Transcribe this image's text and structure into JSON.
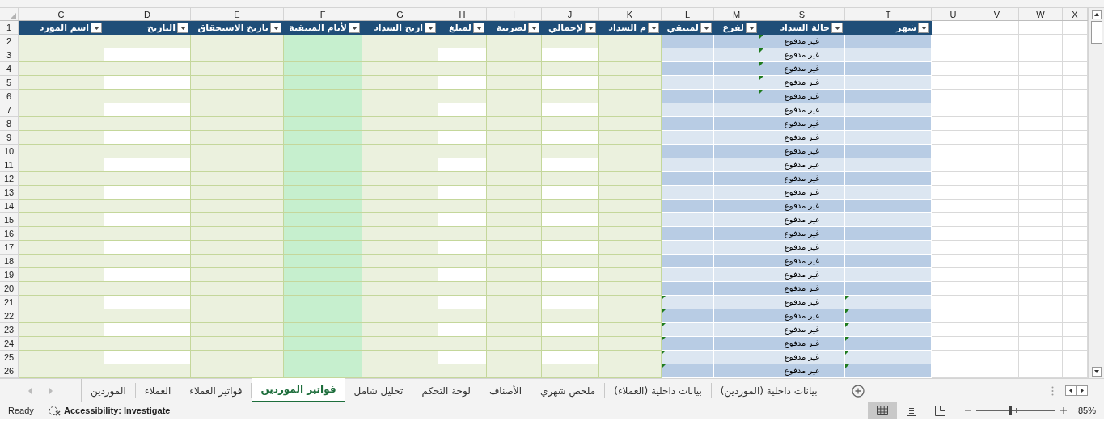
{
  "columns": [
    {
      "letter": "X"
    },
    {
      "letter": "W"
    },
    {
      "letter": "V"
    },
    {
      "letter": "U"
    },
    {
      "letter": "T",
      "header": "شهر"
    },
    {
      "letter": "S",
      "header": "حالة السداد"
    },
    {
      "letter": "M",
      "header": "لفرع"
    },
    {
      "letter": "L",
      "header": "لمتبقي"
    },
    {
      "letter": "K",
      "header": "م السداد"
    },
    {
      "letter": "J",
      "header": "لإجمالي"
    },
    {
      "letter": "I",
      "header": "لضريبة"
    },
    {
      "letter": "H",
      "header": "لمبلغ"
    },
    {
      "letter": "G",
      "header": "اريخ السداد"
    },
    {
      "letter": "F",
      "header": "لأيام المتبقية"
    },
    {
      "letter": "E",
      "header": "تاريخ الاستحقاق"
    },
    {
      "letter": "D",
      "header": "التاريخ"
    },
    {
      "letter": "C",
      "header": "اسم المورد"
    }
  ],
  "header_row": "1",
  "rows": [
    {
      "number": "2",
      "status": "غير مدفوع",
      "flag_remaining": false,
      "flag_status": true,
      "flag_month": false
    },
    {
      "number": "3",
      "status": "غير مدفوع",
      "flag_remaining": false,
      "flag_status": true,
      "flag_month": false
    },
    {
      "number": "4",
      "status": "غير مدفوع",
      "flag_remaining": false,
      "flag_status": true,
      "flag_month": false
    },
    {
      "number": "5",
      "status": "غير مدفوع",
      "flag_remaining": false,
      "flag_status": true,
      "flag_month": false
    },
    {
      "number": "6",
      "status": "غير مدفوع",
      "flag_remaining": false,
      "flag_status": true,
      "flag_month": false
    },
    {
      "number": "7",
      "status": "غير مدفوع",
      "flag_remaining": false,
      "flag_status": false,
      "flag_month": false
    },
    {
      "number": "8",
      "status": "غير مدفوع",
      "flag_remaining": false,
      "flag_status": false,
      "flag_month": false
    },
    {
      "number": "9",
      "status": "غير مدفوع",
      "flag_remaining": false,
      "flag_status": false,
      "flag_month": false
    },
    {
      "number": "10",
      "status": "غير مدفوع",
      "flag_remaining": false,
      "flag_status": false,
      "flag_month": false
    },
    {
      "number": "11",
      "status": "غير مدفوع",
      "flag_remaining": false,
      "flag_status": false,
      "flag_month": false
    },
    {
      "number": "12",
      "status": "غير مدفوع",
      "flag_remaining": false,
      "flag_status": false,
      "flag_month": false
    },
    {
      "number": "13",
      "status": "غير مدفوع",
      "flag_remaining": false,
      "flag_status": false,
      "flag_month": false
    },
    {
      "number": "14",
      "status": "غير مدفوع",
      "flag_remaining": false,
      "flag_status": false,
      "flag_month": false
    },
    {
      "number": "15",
      "status": "غير مدفوع",
      "flag_remaining": false,
      "flag_status": false,
      "flag_month": false
    },
    {
      "number": "16",
      "status": "غير مدفوع",
      "flag_remaining": false,
      "flag_status": false,
      "flag_month": false
    },
    {
      "number": "17",
      "status": "غير مدفوع",
      "flag_remaining": false,
      "flag_status": false,
      "flag_month": false
    },
    {
      "number": "18",
      "status": "غير مدفوع",
      "flag_remaining": false,
      "flag_status": false,
      "flag_month": false
    },
    {
      "number": "19",
      "status": "غير مدفوع",
      "flag_remaining": false,
      "flag_status": false,
      "flag_month": false
    },
    {
      "number": "20",
      "status": "غير مدفوع",
      "flag_remaining": false,
      "flag_status": false,
      "flag_month": false
    },
    {
      "number": "21",
      "status": "غير مدفوع",
      "flag_remaining": true,
      "flag_status": false,
      "flag_month": true
    },
    {
      "number": "22",
      "status": "غير مدفوع",
      "flag_remaining": true,
      "flag_status": false,
      "flag_month": true
    },
    {
      "number": "23",
      "status": "غير مدفوع",
      "flag_remaining": true,
      "flag_status": false,
      "flag_month": true
    },
    {
      "number": "24",
      "status": "غير مدفوع",
      "flag_remaining": true,
      "flag_status": false,
      "flag_month": true
    },
    {
      "number": "25",
      "status": "غير مدفوع",
      "flag_remaining": true,
      "flag_status": false,
      "flag_month": true
    },
    {
      "number": "26",
      "status": "غير مدفوع",
      "flag_remaining": true,
      "flag_status": false,
      "flag_month": true
    }
  ],
  "sheet_tabs": [
    {
      "label": "بيانات داخلية (الموردين)",
      "selected": false
    },
    {
      "label": "بيانات داخلية (العملاء)",
      "selected": false
    },
    {
      "label": "ملخص شهري",
      "selected": false
    },
    {
      "label": "الأصناف",
      "selected": false
    },
    {
      "label": "لوحة التحكم",
      "selected": false
    },
    {
      "label": "تحليل شامل",
      "selected": false
    },
    {
      "label": "فواتير الموردين",
      "selected": true
    },
    {
      "label": "فواتير العملاء",
      "selected": false
    },
    {
      "label": "العملاء",
      "selected": false
    },
    {
      "label": "الموردين",
      "selected": false
    }
  ],
  "status_bar": {
    "mode": "Ready",
    "accessibility": "Accessibility: Investigate",
    "views": [
      {
        "kind": "normal",
        "selected": true
      },
      {
        "kind": "page_layout",
        "selected": false
      },
      {
        "kind": "page_break",
        "selected": false
      }
    ],
    "zoom": {
      "level": 0.43,
      "reading": "85%"
    }
  }
}
